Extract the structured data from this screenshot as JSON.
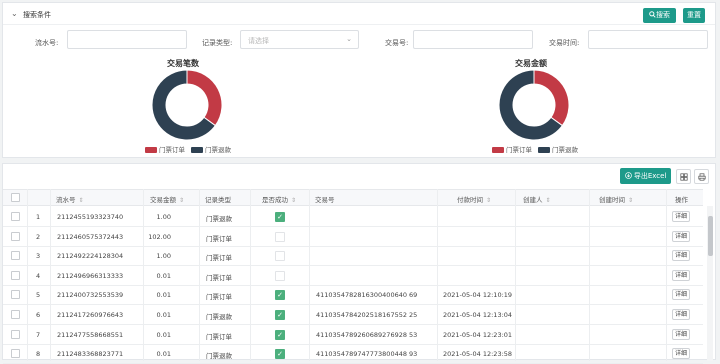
{
  "search": {
    "title": "搜索条件",
    "search_button": "搜索",
    "reset_button": "重置",
    "fields": {
      "serial_label": "流水号:",
      "record_type_label": "记录类型:",
      "record_type_placeholder": "请选择",
      "trade_no_label": "交易号:",
      "trade_time_label": "交易时间:"
    }
  },
  "charts": {
    "count": {
      "title": "交易笔数",
      "legend": [
        "门票订单",
        "门票退款"
      ]
    },
    "amount": {
      "title": "交易金额",
      "legend": [
        "门票订单",
        "门票退款"
      ]
    }
  },
  "chart_data": [
    {
      "type": "pie",
      "title": "交易笔数",
      "labels": [
        "门票订单",
        "门票退款"
      ],
      "values": [
        35,
        65
      ],
      "colors": [
        "#c23a45",
        "#2e4152"
      ]
    },
    {
      "type": "pie",
      "title": "交易金额",
      "labels": [
        "门票订单",
        "门票退款"
      ],
      "values": [
        35,
        65
      ],
      "colors": [
        "#c23a45",
        "#2e4152"
      ]
    }
  ],
  "colors": {
    "accent": "#1d9a8a",
    "order": "#c23a45",
    "refund": "#2e4152",
    "check": "#4caf7d"
  },
  "toolbar": {
    "export_label": "导出Excel"
  },
  "table": {
    "columns": {
      "serial": "流水号",
      "amount": "交易金额",
      "record_type": "记录类型",
      "success": "是否成功",
      "trade_no": "交易号",
      "pay_time": "付款时间",
      "creator": "创建人",
      "create_time": "创建时间",
      "action": "操作"
    },
    "detail_label": "详细",
    "rows": [
      {
        "idx": "1",
        "serial": "2112455193323740",
        "amount": "1.00",
        "type": "门票退款",
        "success": true,
        "trade_no": "",
        "pay_time": ""
      },
      {
        "idx": "2",
        "serial": "2112460575372443",
        "amount": "102.00",
        "type": "门票订单",
        "success": false,
        "trade_no": "",
        "pay_time": ""
      },
      {
        "idx": "3",
        "serial": "2112492224128304",
        "amount": "1.00",
        "type": "门票订单",
        "success": false,
        "trade_no": "",
        "pay_time": ""
      },
      {
        "idx": "4",
        "serial": "2112496966313333",
        "amount": "0.01",
        "type": "门票订单",
        "success": false,
        "trade_no": "",
        "pay_time": ""
      },
      {
        "idx": "5",
        "serial": "2112400732553539",
        "amount": "0.01",
        "type": "门票订单",
        "success": true,
        "trade_no": "4110354782816300400640 69",
        "pay_time": "2021-05-04 12:10:19"
      },
      {
        "idx": "6",
        "serial": "2112417260976643",
        "amount": "0.01",
        "type": "门票退款",
        "success": true,
        "trade_no": "4110354784202518167552 25",
        "pay_time": "2021-05-04 12:13:04"
      },
      {
        "idx": "7",
        "serial": "2112477558668551",
        "amount": "0.01",
        "type": "门票订单",
        "success": true,
        "trade_no": "4110354789260689276928 53",
        "pay_time": "2021-05-04 12:23:01"
      },
      {
        "idx": "8",
        "serial": "2112483368823771",
        "amount": "0.01",
        "type": "门票退款",
        "success": true,
        "trade_no": "4110354789747773800448 93",
        "pay_time": "2021-05-04 12:23:58"
      }
    ]
  }
}
